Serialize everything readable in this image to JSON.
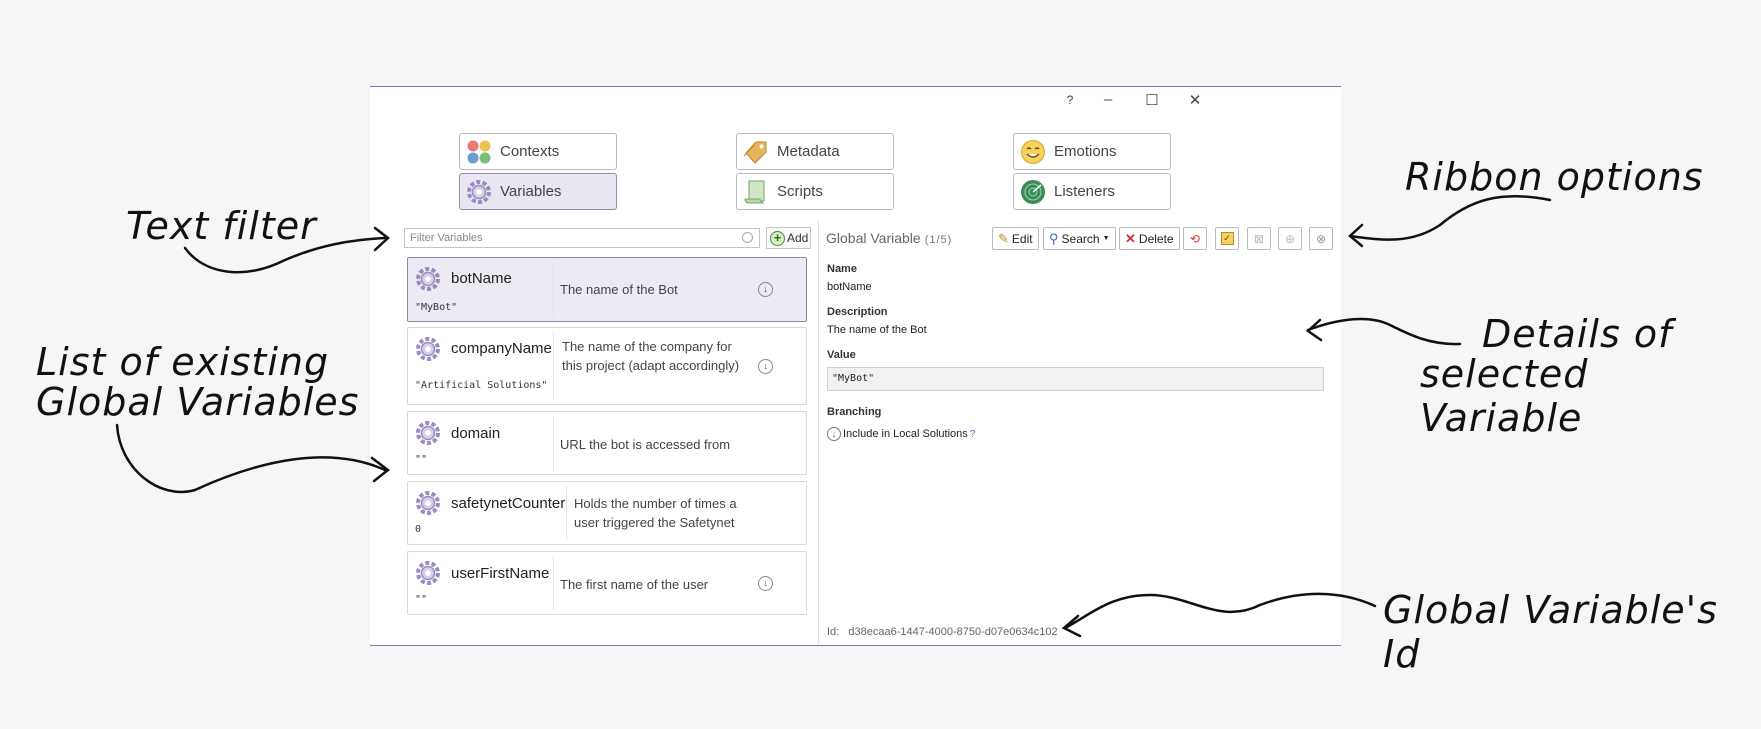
{
  "window": {
    "help": "?",
    "minimize": "–",
    "maximize": "☐",
    "close": "✕"
  },
  "nav": {
    "contexts": "Contexts",
    "variables": "Variables",
    "metadata": "Metadata",
    "scripts": "Scripts",
    "emotions": "Emotions",
    "listeners": "Listeners"
  },
  "filter": {
    "placeholder": "Filter Variables"
  },
  "add_label": "Add",
  "variables": [
    {
      "name": "botName",
      "value": "\"MyBot\"",
      "description": "The name of the Bot"
    },
    {
      "name": "companyName",
      "value": "\"Artificial Solutions\"",
      "description": "The name of the company for this project (adapt accordingly)"
    },
    {
      "name": "domain",
      "value": "\"\"",
      "description": "URL the bot is accessed from"
    },
    {
      "name": "safetynetCounter",
      "value": "0",
      "description": "Holds the number of times a user triggered the Safetynet"
    },
    {
      "name": "userFirstName",
      "value": "\"\"",
      "description": "The first name of the user"
    }
  ],
  "details": {
    "title": "Global Variable",
    "count": "(1/5)",
    "edit": "Edit",
    "search": "Search",
    "delete": "Delete",
    "name_label": "Name",
    "name_value": "botName",
    "description_label": "Description",
    "description_value": "The name of the Bot",
    "value_label": "Value",
    "value_value": "\"MyBot\"",
    "branching_label": "Branching",
    "include_label": "Include in Local Solutions",
    "include_help": "?",
    "id_label": "Id:",
    "id_value": "d38ecaa6-1447-4000-8750-d07e0634c102"
  },
  "annotations": {
    "text_filter": "Text filter",
    "list_line1": "List of existing",
    "list_line2": "Global Variables",
    "ribbon": "Ribbon options",
    "details_line1": "Details of",
    "details_line2": "selected Variable",
    "id": "Global Variable's Id"
  },
  "colors": {
    "accent": "#8e8aaf",
    "selected_bg": "#eceaf2",
    "gear": "#9a8ac0"
  }
}
